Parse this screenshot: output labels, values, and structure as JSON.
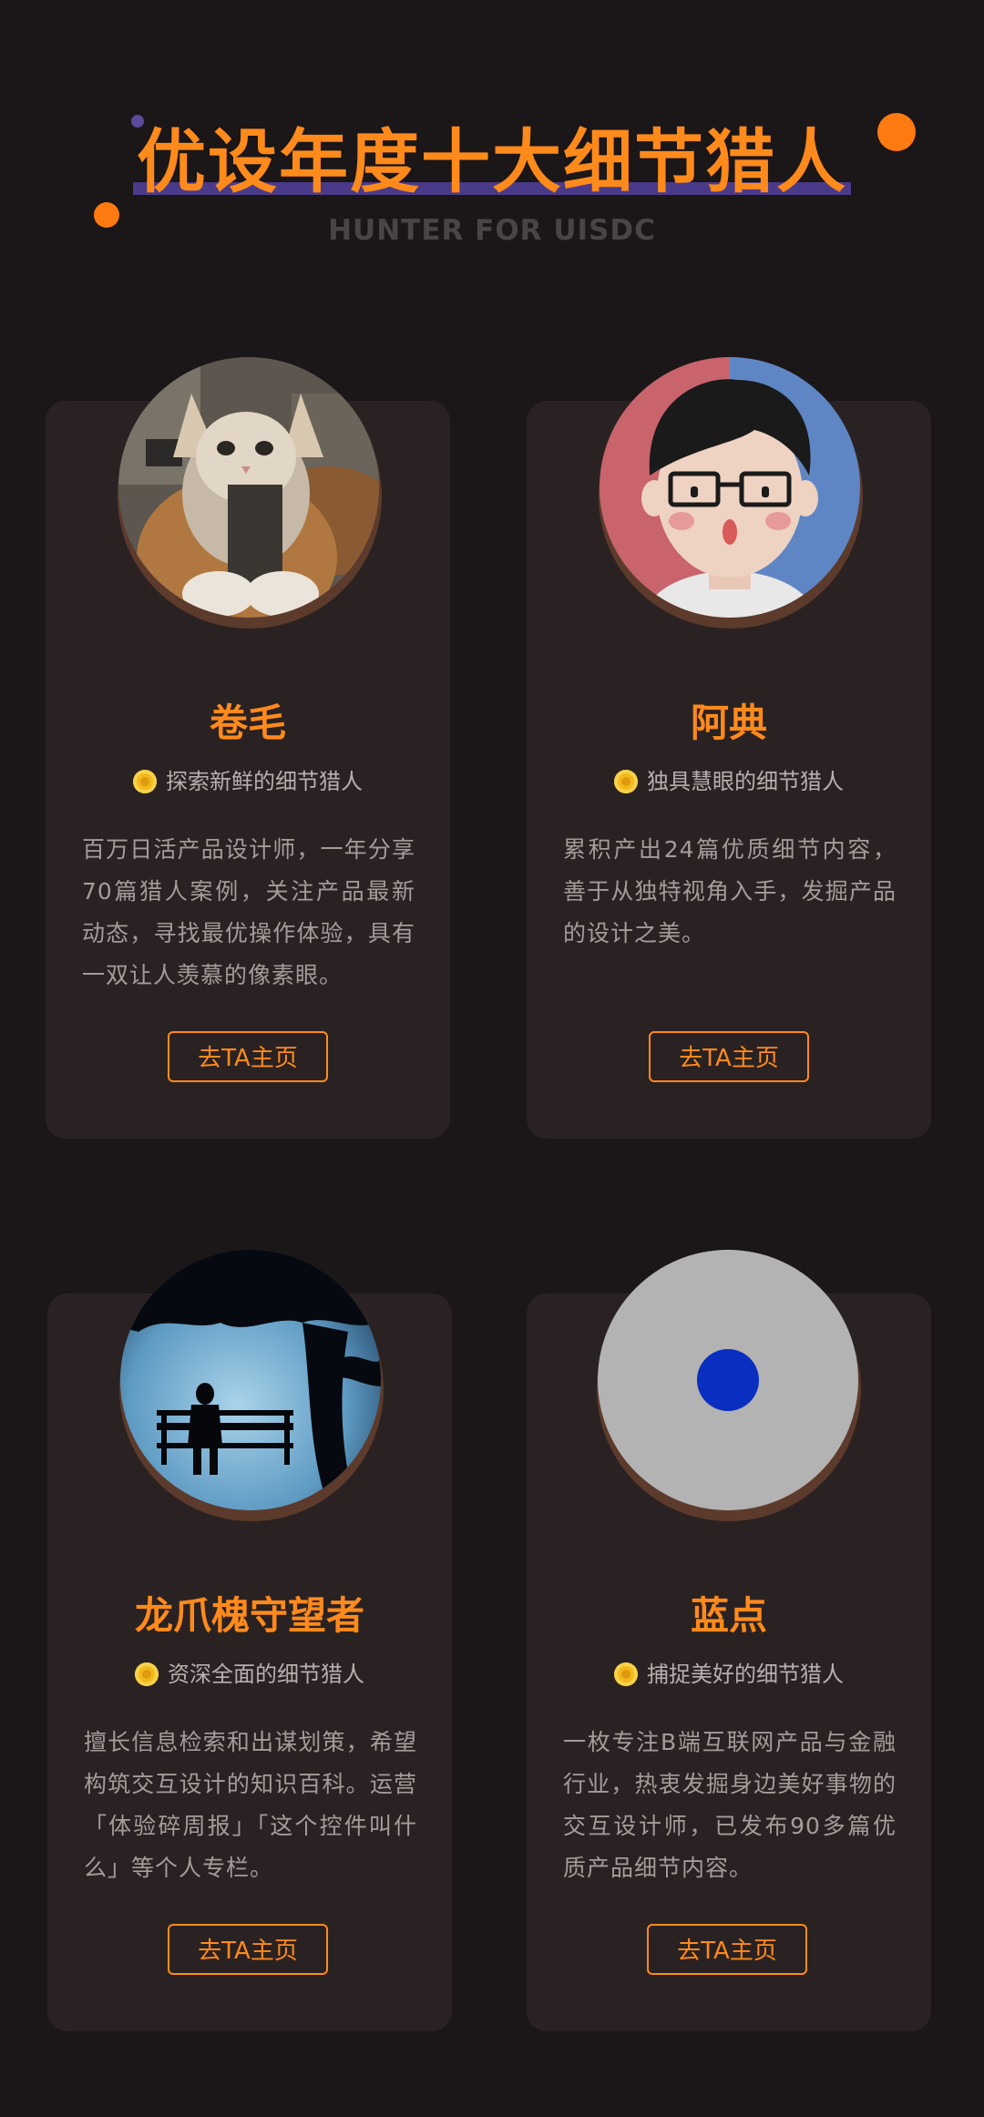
{
  "header": {
    "title": "优设年度十大细节猎人",
    "subtitle": "HUNTER FOR UISDC"
  },
  "colors": {
    "accent": "#ff8a1c",
    "background": "#1b1617",
    "card": "#2a2222",
    "underline": "#4a3a8a"
  },
  "cards": [
    {
      "avatar": "cat-photo",
      "name": "卷毛",
      "tag": "探索新鲜的细节猎人",
      "description": "百万日活产品设计师，一年分享70篇猎人案例，关注产品最新动态，寻找最优操作体验，具有一双让人羡慕的像素眼。",
      "button": "去TA主页"
    },
    {
      "avatar": "cartoon-glasses-man",
      "name": "阿典",
      "tag": "独具慧眼的细节猎人",
      "description": "累积产出24篇优质细节内容，善于从独特视角入手，发掘产品的设计之美。",
      "button": "去TA主页"
    },
    {
      "avatar": "silhouette-bench-tree",
      "name": "龙爪槐守望者",
      "tag": "资深全面的细节猎人",
      "description": "擅长信息检索和出谋划策，希望构筑交互设计的知识百科。运营「体验碎周报」「这个控件叫什么」等个人专栏。",
      "button": "去TA主页"
    },
    {
      "avatar": "blue-dot",
      "name": "蓝点",
      "tag": "捕捉美好的细节猎人",
      "description": "一枚专注B端互联网产品与金融行业，热衷发掘身边美好事物的交互设计师，已发布90多篇优质产品细节内容。",
      "button": "去TA主页"
    }
  ]
}
